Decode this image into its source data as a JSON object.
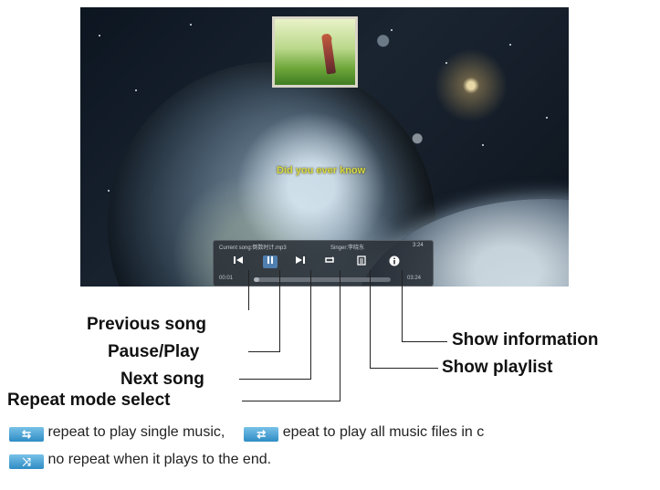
{
  "player": {
    "lyric": "Did you ever know",
    "current_song": "Current song:倒数时计.mp3",
    "singer": "Singer:李晓东",
    "duration_top": "3:24",
    "time_elapsed": "00:01",
    "time_total": "03:24",
    "progress": 0.04
  },
  "controls": {
    "prev_icon": "skip-previous-icon",
    "pause_icon": "pause-icon",
    "next_icon": "skip-next-icon",
    "repeat_icon": "repeat-icon",
    "playlist_icon": "playlist-icon",
    "info_icon": "info-icon"
  },
  "callouts": {
    "previous_song": "Previous song",
    "pause_play": "Pause/Play",
    "next_song": "Next song",
    "repeat_mode": "Repeat mode select",
    "show_information": "Show information",
    "show_playlist": "Show playlist"
  },
  "legend": {
    "single_text": "repeat to play single music,",
    "all_text": "epeat to play all music files in c",
    "none_text": "no repeat when it plays to the  end.",
    "single_icon": "repeat-single-icon",
    "all_icon": "repeat-all-icon",
    "none_icon": "no-repeat-icon"
  },
  "colors": {
    "lyric": "#d8d840",
    "control_bar": "#2c3136",
    "active_button": "#4f7fb0",
    "legend_icon": "#2f8cc4"
  }
}
